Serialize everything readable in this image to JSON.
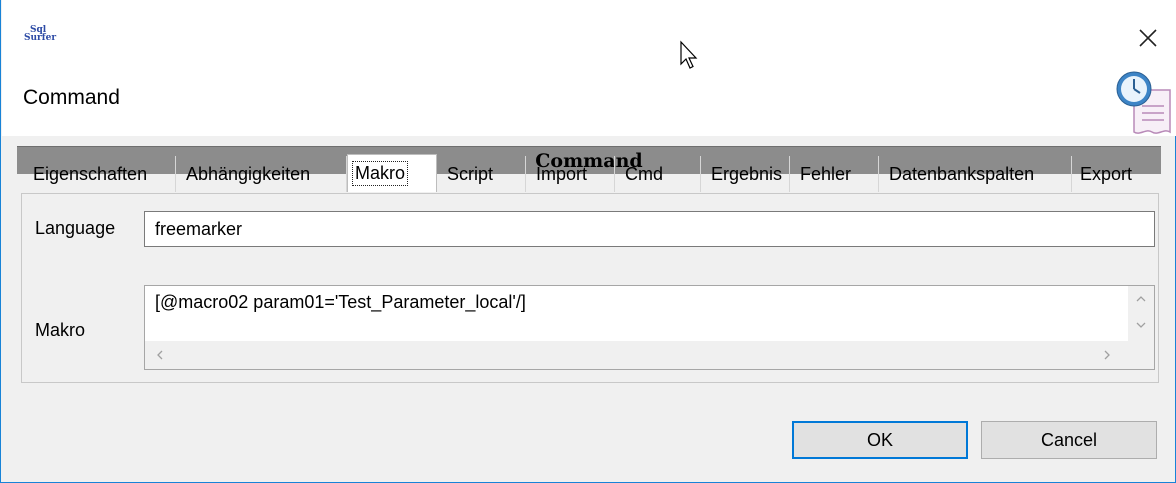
{
  "app": {
    "logo_line1": "Sql",
    "logo_line2": "Surfer",
    "dialog_title": "Command"
  },
  "banner": {
    "title": "Command"
  },
  "tabs": [
    {
      "label": "Eigenschaften",
      "active": false
    },
    {
      "label": "Abhängigkeiten",
      "active": false
    },
    {
      "label": "Makro",
      "active": true
    },
    {
      "label": "Script",
      "active": false
    },
    {
      "label": "Import",
      "active": false
    },
    {
      "label": "Cmd",
      "active": false
    },
    {
      "label": "Ergebnis",
      "active": false
    },
    {
      "label": "Fehler",
      "active": false
    },
    {
      "label": "Datenbankspalten",
      "active": false
    },
    {
      "label": "Export",
      "active": false
    }
  ],
  "form": {
    "language_label": "Language",
    "language_value": "freemarker",
    "makro_label": "Makro",
    "makro_value": "[@macro02 param01='Test_Parameter_local'/]"
  },
  "buttons": {
    "ok": "OK",
    "cancel": "Cancel"
  },
  "icons": {
    "close": "close-icon",
    "dialog": "clock-document-icon",
    "cursor": "mouse-pointer-icon"
  },
  "colors": {
    "accent": "#0078d7",
    "banner": "#8c8c8c",
    "window_border": "#1883d7"
  }
}
